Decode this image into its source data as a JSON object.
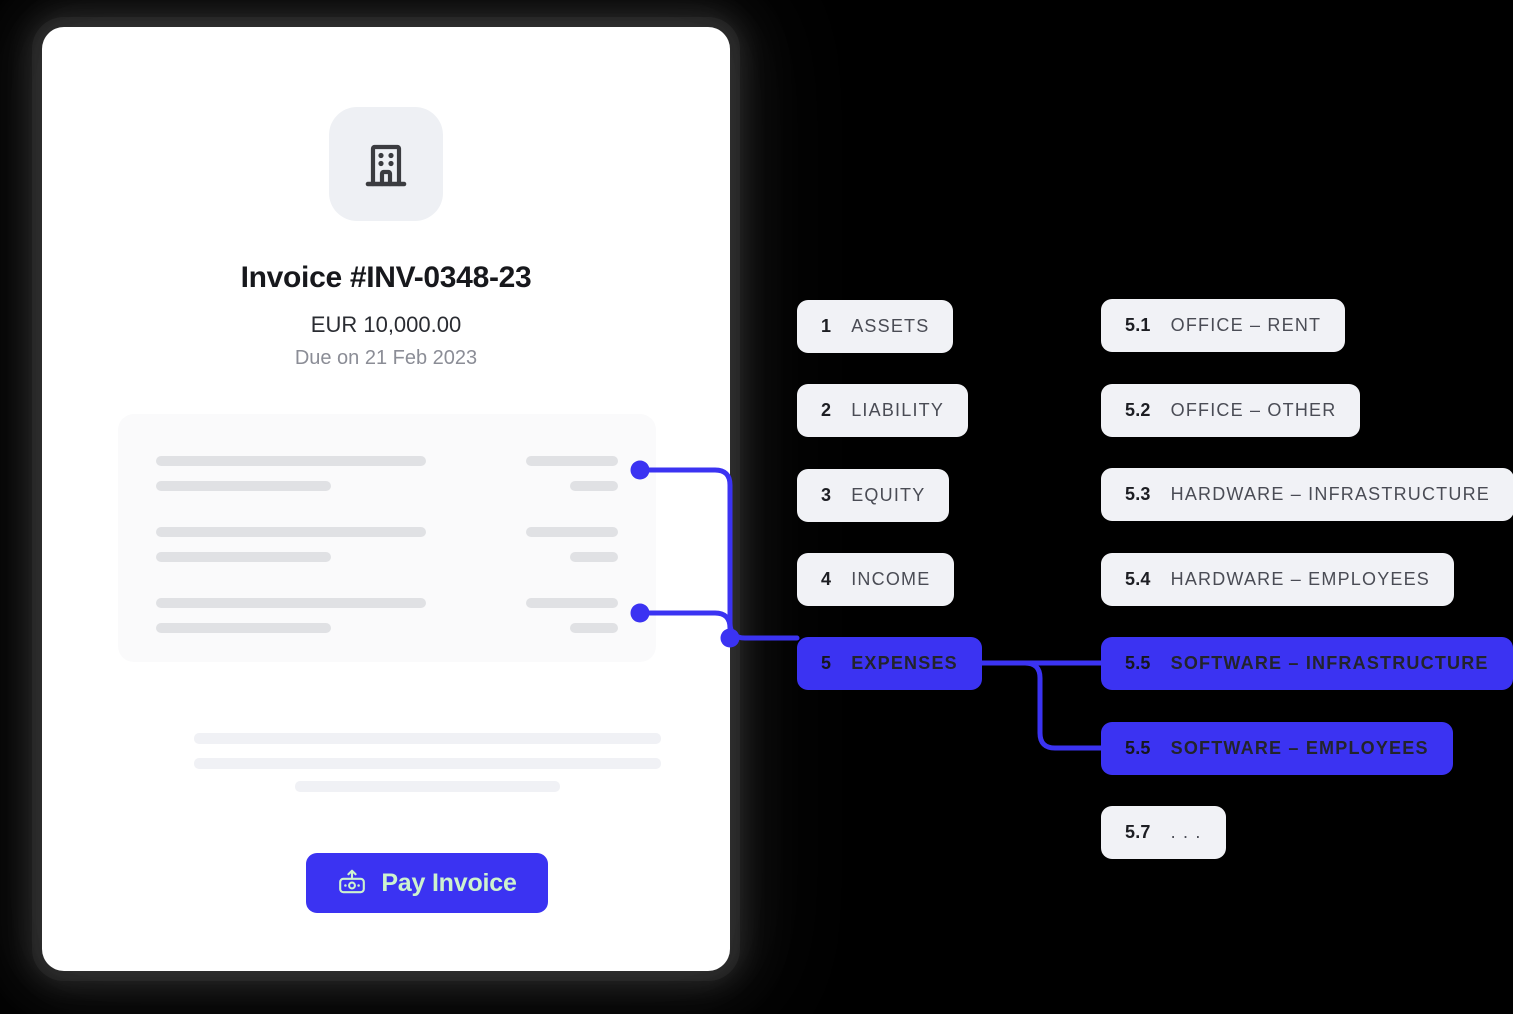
{
  "theme": {
    "accent": "#3b33f2",
    "tag_bg": "#f1f2f6",
    "card_bg": "#ffffff",
    "page_bg": "#000000",
    "pay_label_color": "#cdf2ce"
  },
  "invoice": {
    "logo_icon": "building-icon",
    "title": "Invoice #INV-0348-23",
    "amount": "EUR 10,000.00",
    "due": "Due on 21 Feb 2023",
    "pay_button": {
      "label": "Pay Invoice",
      "icon": "payment-terminal-upload-icon"
    }
  },
  "accounts": {
    "primary": [
      {
        "num": "1",
        "label": "ASSETS",
        "active": false
      },
      {
        "num": "2",
        "label": "LIABILITY",
        "active": false
      },
      {
        "num": "3",
        "label": "EQUITY",
        "active": false
      },
      {
        "num": "4",
        "label": "INCOME",
        "active": false
      },
      {
        "num": "5",
        "label": "EXPENSES",
        "active": true
      }
    ],
    "sub": [
      {
        "num": "5.1",
        "label": "OFFICE – RENT",
        "active": false
      },
      {
        "num": "5.2",
        "label": "OFFICE – OTHER",
        "active": false
      },
      {
        "num": "5.3",
        "label": "HARDWARE – INFRASTRUCTURE",
        "active": false
      },
      {
        "num": "5.4",
        "label": "HARDWARE – EMPLOYEES",
        "active": false
      },
      {
        "num": "5.5",
        "label": "SOFTWARE – INFRASTRUCTURE",
        "active": true
      },
      {
        "num": "5.5",
        "label": "SOFTWARE – EMPLOYEES",
        "active": true
      },
      {
        "num": "5.7",
        "label": ". . .",
        "active": false
      }
    ]
  }
}
